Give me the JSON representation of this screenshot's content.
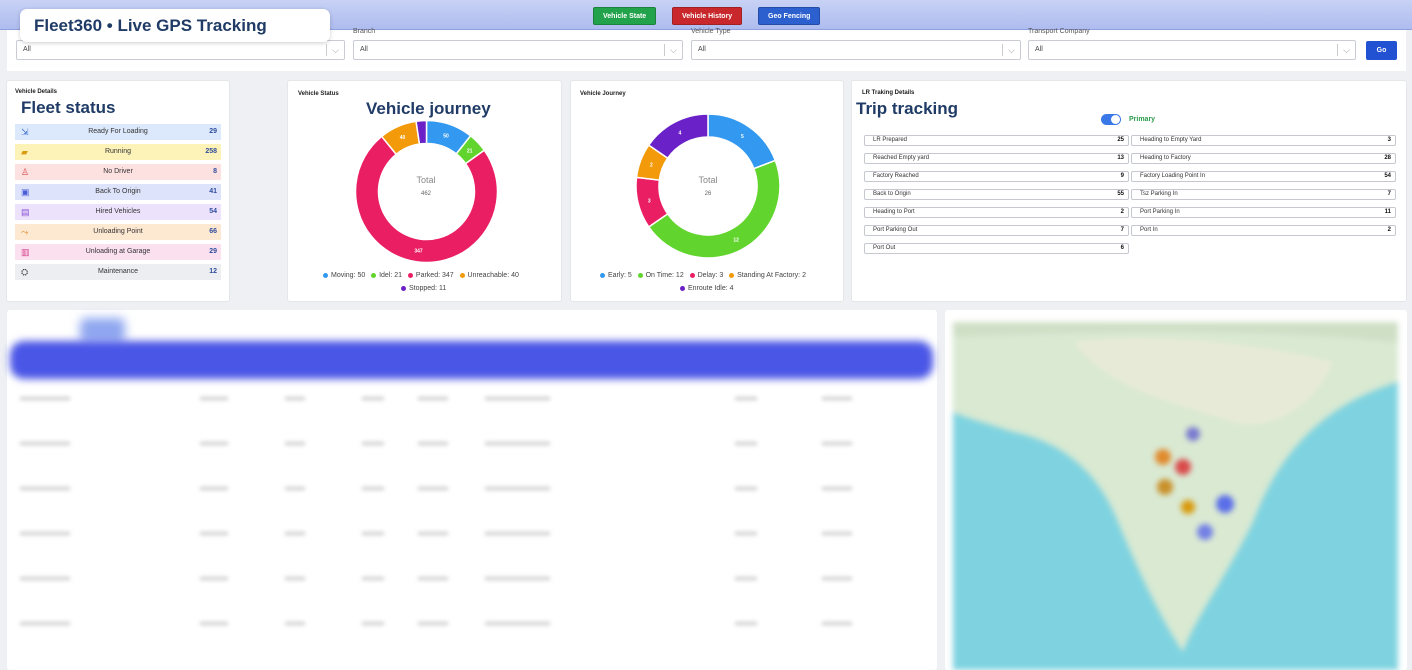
{
  "header": {
    "brand": "Fleet360  •  Live GPS Tracking",
    "buttons": [
      {
        "label": "Vehicle State",
        "color": "#22a34b"
      },
      {
        "label": "Vehicle History",
        "color": "#c8282c"
      },
      {
        "label": "Geo Fencing",
        "color": "#2d60cf"
      }
    ]
  },
  "filters": {
    "items": [
      {
        "label": "",
        "value": "All"
      },
      {
        "label": "Branch",
        "value": "All"
      },
      {
        "label": "Vehicle Type",
        "value": "All"
      },
      {
        "label": "Transport Company",
        "value": "All"
      }
    ],
    "go_label": "Go"
  },
  "fleet_status": {
    "heading": "Fleet status",
    "card_title": "Vehicle Details",
    "items": [
      {
        "icon": "loading-icon",
        "label": "Ready For Loading",
        "count": "29",
        "color": "#dce8fb",
        "icon_color": "#3b6fd6"
      },
      {
        "icon": "truck-icon",
        "label": "Running",
        "count": "258",
        "color": "#fdf2b8",
        "icon_color": "#d99a0c"
      },
      {
        "icon": "person-icon",
        "label": "No Driver",
        "count": "8",
        "color": "#fde0e0",
        "icon_color": "#d94a4a"
      },
      {
        "icon": "truck-back-icon",
        "label": "Back To Origin",
        "count": "41",
        "color": "#dde3fb",
        "icon_color": "#4a5fd6"
      },
      {
        "icon": "bus-icon",
        "label": "Hired Vehicles",
        "count": "54",
        "color": "#ece2fb",
        "icon_color": "#8a4fd6"
      },
      {
        "icon": "unload-icon",
        "label": "Unloading Point",
        "count": "66",
        "color": "#fde8d2",
        "icon_color": "#e08a2c"
      },
      {
        "icon": "garage-icon",
        "label": "Unloading at Garage",
        "count": "29",
        "color": "#fbe0ef",
        "icon_color": "#d63a8a"
      },
      {
        "icon": "maintenance-icon",
        "label": "Maintenance",
        "count": "12",
        "color": "#eceef1",
        "icon_color": "#444"
      }
    ]
  },
  "vehicle_status": {
    "card_title": "Vehicle Status",
    "heading": "Vehicle journey",
    "total_label": "Total",
    "total_value": "462"
  },
  "vehicle_journey": {
    "card_title": "Vehicle Journey",
    "total_label": "Total",
    "total_value": "26"
  },
  "chart_data": [
    {
      "type": "pie",
      "title": "Vehicle Status",
      "categories": [
        "Moving",
        "Idel",
        "Parked",
        "Unreachable",
        "Stopped"
      ],
      "values": [
        50,
        21,
        347,
        40,
        11
      ],
      "colors": [
        "#3399f0",
        "#62d42e",
        "#ea1e63",
        "#f29a0a",
        "#6a21c8"
      ],
      "legend": [
        "Moving: 50",
        "Idel: 21",
        "Parked: 347",
        "Unreachable: 40",
        "Stopped: 11"
      ],
      "slice_labels": [
        "50",
        "21",
        "347",
        "40",
        ""
      ]
    },
    {
      "type": "pie",
      "title": "Vehicle Journey",
      "categories": [
        "Early",
        "On Time",
        "Delay",
        "Standing At Factory",
        "Enroute Idle"
      ],
      "values": [
        5,
        12,
        3,
        2,
        4
      ],
      "colors": [
        "#3399f0",
        "#62d42e",
        "#ea1e63",
        "#f29a0a",
        "#6a21c8"
      ],
      "legend": [
        "Early: 5",
        "On Time: 12",
        "Delay: 3",
        "Standing At Factory: 2",
        "Enroute Idle: 4"
      ],
      "slice_labels": [
        "5",
        "12",
        "3",
        "2",
        "4"
      ]
    }
  ],
  "trip_tracking": {
    "heading": "Trip tracking",
    "card_title": "LR Traking Details",
    "toggle_label": "Primary",
    "left": [
      {
        "label": "LR Prepared",
        "value": "25"
      },
      {
        "label": "Reached Empty yard",
        "value": "13"
      },
      {
        "label": "Factory Reached",
        "value": "9"
      },
      {
        "label": "Back to Origin",
        "value": "55"
      },
      {
        "label": "Heading to Port",
        "value": "2"
      },
      {
        "label": "Port Parking Out",
        "value": "7"
      },
      {
        "label": "Port Out",
        "value": "6"
      }
    ],
    "right": [
      {
        "label": "Heading to Empty Yard",
        "value": "3"
      },
      {
        "label": "Heading to Factory",
        "value": "28"
      },
      {
        "label": "Factory Loading Point In",
        "value": "54"
      },
      {
        "label": "Tsz Parking In",
        "value": "7"
      },
      {
        "label": "Port Parking In",
        "value": "11"
      },
      {
        "label": "Port In",
        "value": "2"
      }
    ]
  }
}
